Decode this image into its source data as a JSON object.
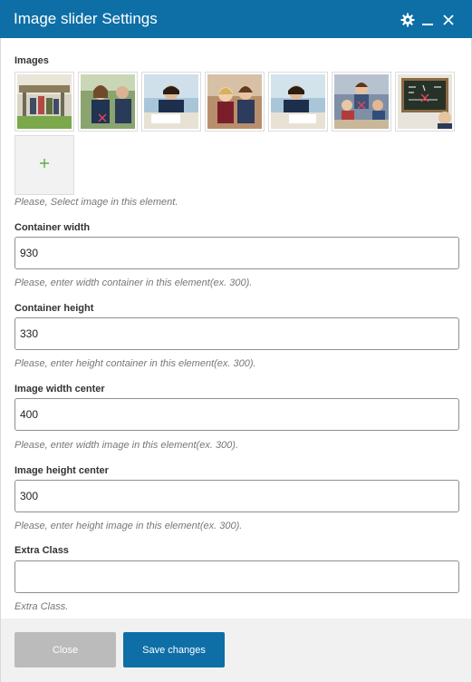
{
  "dialog": {
    "title": "Image slider Settings",
    "accent_color": "#0e6fa7"
  },
  "images": {
    "label": "Images",
    "thumbnails": [
      {
        "alt": "playground-photo",
        "has_remove_icon": true
      },
      {
        "alt": "students-photo",
        "has_remove_icon": true
      },
      {
        "alt": "classroom-writing-photo",
        "has_remove_icon": false
      },
      {
        "alt": "children-smiling-photo",
        "has_remove_icon": false
      },
      {
        "alt": "classroom-writing-photo-2",
        "has_remove_icon": false
      },
      {
        "alt": "teacher-students-photo",
        "has_remove_icon": true
      },
      {
        "alt": "chalkboard-photo",
        "has_remove_icon": true
      }
    ],
    "add_icon": "plus-icon",
    "help": "Please, Select image in this element."
  },
  "container_width": {
    "label": "Container width",
    "value": "930",
    "help": "Please, enter width container in this element(ex. 300)."
  },
  "container_height": {
    "label": "Container height",
    "value": "330",
    "help": "Please, enter height container in this element(ex. 300)."
  },
  "image_width_center": {
    "label": "Image width center",
    "value": "400",
    "help": "Please, enter width image in this element(ex. 300)."
  },
  "image_height_center": {
    "label": "Image height center",
    "value": "300",
    "help": "Please, enter height image in this element(ex. 300)."
  },
  "extra_class": {
    "label": "Extra Class",
    "value": "",
    "help": "Extra Class."
  },
  "footer": {
    "close_label": "Close",
    "save_label": "Save changes"
  }
}
